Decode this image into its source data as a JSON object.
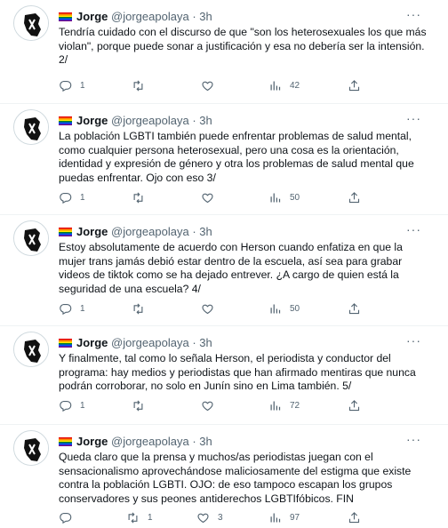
{
  "tweets": [
    {
      "author": "Jorge",
      "handle": "@jorgeapolaya",
      "sep": "·",
      "time": "3h",
      "text": "Tendría cuidado con el discurso de que \"son los heterosexuales los que más violan\", porque puede sonar a justificación y esa no debería ser la intensión. 2/",
      "replies": "1",
      "retweets": "",
      "likes": "",
      "views": "42"
    },
    {
      "author": "Jorge",
      "handle": "@jorgeapolaya",
      "sep": "·",
      "time": "3h",
      "text": "La población LGBTI también puede enfrentar problemas de salud mental, como cualquier persona heterosexual, pero una cosa es la orientación, identidad y expresión de género y otra los problemas de salud mental que puedas enfrentar. Ojo con eso 3/",
      "replies": "1",
      "retweets": "",
      "likes": "",
      "views": "50"
    },
    {
      "author": "Jorge",
      "handle": "@jorgeapolaya",
      "sep": "·",
      "time": "3h",
      "text": "Estoy absolutamente de acuerdo con Herson cuando  enfatiza en que la mujer trans jamás debió estar dentro de la escuela, así sea para grabar videos de tiktok como se ha dejado entrever. ¿A cargo de quien está la seguridad de una escuela? 4/",
      "replies": "1",
      "retweets": "",
      "likes": "",
      "views": "50"
    },
    {
      "author": "Jorge",
      "handle": "@jorgeapolaya",
      "sep": "·",
      "time": "3h",
      "text": "Y finalmente, tal como lo señala Herson, el periodista y conductor del programa: hay medios y periodistas que han afirmado mentiras que nunca podrán corroborar, no solo en Junín sino en Lima también. 5/",
      "replies": "1",
      "retweets": "",
      "likes": "",
      "views": "72"
    },
    {
      "author": "Jorge",
      "handle": "@jorgeapolaya",
      "sep": "·",
      "time": "3h",
      "text": "Queda claro que la prensa y muchos/as periodistas juegan con el sensacionalismo aprovechándose maliciosamente del estigma que existe contra la población LGBTI. OJO: de eso tampoco escapan los grupos conservadores y sus peones antiderechos LGBTIfóbicos. FIN",
      "replies": "",
      "retweets": "1",
      "likes": "3",
      "views": "97"
    }
  ],
  "icons": {
    "reply": "reply-icon",
    "retweet": "retweet-icon",
    "like": "like-icon",
    "views": "views-icon",
    "share": "share-icon",
    "more": "more-icon"
  },
  "colors": {
    "text": "#0f1419",
    "muted": "#536471",
    "border": "#eff3f4"
  }
}
